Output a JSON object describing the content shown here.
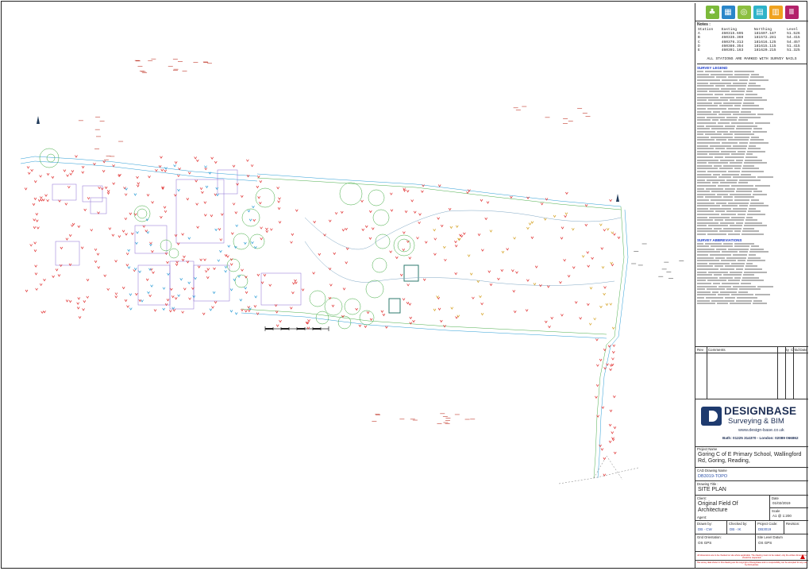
{
  "logos": [
    {
      "icon": "tree-icon",
      "color": "#7cba3a",
      "glyph": "♣"
    },
    {
      "icon": "building-icon",
      "color": "#2a86c9",
      "glyph": "▦"
    },
    {
      "icon": "target-icon",
      "color": "#8cbf3f",
      "glyph": "◎"
    },
    {
      "icon": "book-icon",
      "color": "#2fb3c9",
      "glyph": "▤"
    },
    {
      "icon": "document-icon",
      "color": "#f0a21f",
      "glyph": "▥"
    },
    {
      "icon": "columns-icon",
      "color": "#b3226b",
      "glyph": "Ⅲ"
    }
  ],
  "notes": {
    "title": "Notes :",
    "headers": [
      "Station",
      "Easting",
      "Northing",
      "Level"
    ],
    "rows": [
      [
        "A",
        "460315.695",
        "181607.187",
        "51.526"
      ],
      [
        "B",
        "460335.369",
        "181572.281",
        "54.415"
      ],
      [
        "C",
        "460376.313",
        "181616.125",
        "54.457"
      ],
      [
        "D",
        "460386.354",
        "181615.115",
        "51.415"
      ],
      [
        "E",
        "460391.163",
        "181620.215",
        "51.325"
      ]
    ],
    "footer": "ALL STATIONS ARE MARKED WITH SURVEY NAILS"
  },
  "legend": {
    "heading_1": "SURVEY LEGEND",
    "heading_2": "SURVEY ABBREVIATIONS"
  },
  "revisions": {
    "headers": [
      "Rev",
      "Comments",
      "By",
      "Chkd",
      "Date"
    ]
  },
  "company": {
    "name": "DESIGNBASE",
    "subtitle": "Surveying & BIM",
    "website": "www.design-base.co.uk",
    "phone": "Bath: 01225 314370 - London: 02089 066862"
  },
  "fields": {
    "project_name_label": "Project Name",
    "project_name": "Goring C of E Primary School, Wallingford Rd, Goring, Reading,",
    "cad_label": "CAD Drawing Name",
    "cad_value": "DB3019-TOPO",
    "title_label": "Drawing Title :",
    "title_value": "SITE PLAN",
    "client_label": "Client:",
    "client_value": "Original Field Of Architecture",
    "agent_label": "Agent:",
    "date_label": "Date",
    "date_value": "01/02/2019",
    "scale_label": "Scale",
    "scale_value": "A1 @ 1:200",
    "drawn_label": "Drawn by:",
    "drawn_value": "DB - CW",
    "checked_label": "Checked by:",
    "checked_value": "DB - IK",
    "code_label": "Project Code:",
    "code_value": "DB3019",
    "revision_label": "Revision:",
    "grid_label": "Grid Orientation:",
    "grid_value": "OS GPS",
    "datum_label": "Site Level Datum",
    "datum_value": "OS GPS"
  },
  "warning": "All dimensions are to be checked on site where applicable. The drawing must not be scaled, only the written dimensions should be respected.",
  "footer_note": "The survey data shown in this drawing are the copyright of Designbase and no responsibility can be accepted for any use by third parties."
}
